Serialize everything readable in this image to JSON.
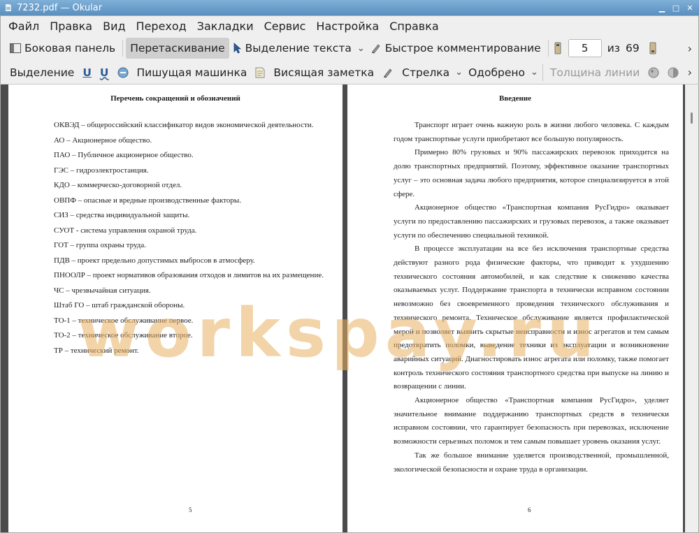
{
  "window": {
    "title": "7232.pdf  — Okular"
  },
  "menubar": {
    "items": [
      "Файл",
      "Правка",
      "Вид",
      "Переход",
      "Закладки",
      "Сервис",
      "Настройка",
      "Справка"
    ]
  },
  "toolbar1": {
    "sidebar": "Боковая панель",
    "drag": "Перетаскивание",
    "text_select": "Выделение текста",
    "quick_comment": "Быстрое комментирование",
    "page_current": "5",
    "of": "из",
    "page_count": "69"
  },
  "toolbar2": {
    "selection": "Выделение",
    "typewriter": "Пишущая машинка",
    "sticky_note": "Висящая заметка",
    "arrow": "Стрелка",
    "stamp": "Одобрено",
    "line_width": "Толщина линии"
  },
  "page_left": {
    "title": "Перечень сокращений и обозначений",
    "items": [
      "ОКВЭД – общероссийский классификатор видов экономической деятельности.",
      "АО – Акционерное общество.",
      "ПАО – Публичное акционерное общество.",
      "ГЭС – гидроэлектростанция.",
      "КДО – коммерческо-договорной отдел.",
      "ОВПФ – опасные и вредные производственные факторы.",
      "СИЗ – средства индивидуальной защиты.",
      "СУОТ - система управления охраной труда.",
      "ГОТ – группа охраны труда.",
      "ПДВ – проект предельно допустимых выбросов в атмосферу.",
      "ПНООЛР – проект нормативов образования отходов и лимитов на их размещение.",
      "ЧС – чрезвычайная ситуация.",
      "Штаб ГО – штаб гражданской обороны.",
      "ТО-1 – техническое обслуживание первое.",
      "ТО-2 – техническое обслуживание второе.",
      "ТР – технический ремонт."
    ],
    "page_number": "5"
  },
  "page_right": {
    "title": "Введение",
    "paragraphs": [
      "Транспорт играет очень важную роль в жизни любого человека. С каждым годом транспортные услуги приобретают все большую популярность.",
      "Примерно 80% грузовых и 90% пассажирских перевозок приходится на долю транспортных предприятий. Поэтому, эффективное оказание транспортных услуг – это основная задача любого предприятия, которое специализируется в этой сфере.",
      "Акционерное общество «Транспортная компания РусГидро» оказывает услуги по предоставлению пассажирских и грузовых перевозок, а также оказывает услуги по обеспечению специальной техникой.",
      "В процессе эксплуатации на все без исключения транспортные средства действуют разного рода физические факторы, что приводит к ухудшению технического состояния автомобилей, и как следствие к снижению качества оказываемых услуг. Поддержание транспорта в технически исправном состоянии невозможно без своевременного проведения технического обслуживания и технического ремонта. Техническое обслуживание является профилактической мерой и позволяет выявить скрытые неисправности и износ агрегатов и тем самым предотвратить поломки, выведение техники из эксплуатации и возникновение аварийных ситуаций. Диагностировать износ агрегата или поломку, также помогает контроль технического состояния транспортного средства при выпуске на линию и возвращении с линии.",
      "Акционерное общество «Транспортная компания РусГидро», уделяет значительное внимание поддержанию транспортных средств в технически исправном состоянии, что гарантирует безопасность при перевозках, исключение возможности серьезных поломок и тем самым повышает уровень оказания услуг.",
      "Так же большое внимание уделяется производственной, промышленной, экологической безопасности и охране труда в организации."
    ],
    "page_number": "6"
  },
  "watermark": "workspay.ru"
}
